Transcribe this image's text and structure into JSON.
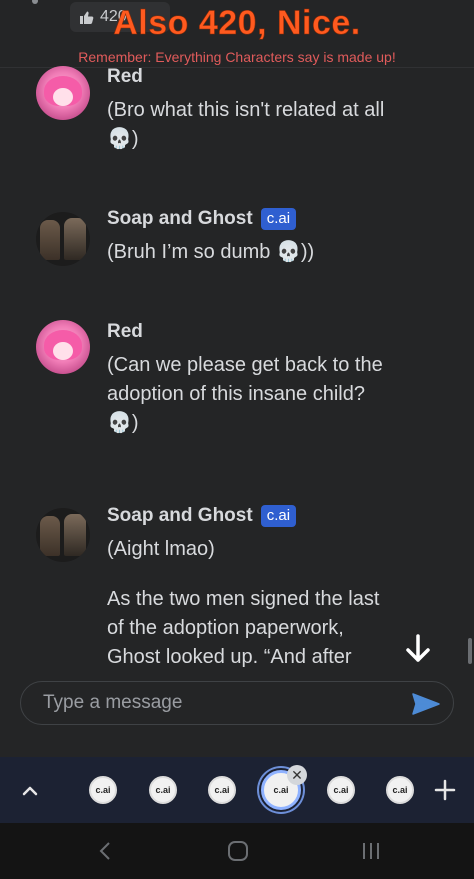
{
  "header": {
    "like_count": "420",
    "meme_caption": "Also 420, Nice.",
    "disclaimer": "Remember: Everything Characters say is made up!"
  },
  "messages": [
    {
      "author": "Red",
      "badge": "",
      "avatar": "pink-hair-avatar",
      "lines": [
        "(Bro what this isn't related at all",
        "💀)"
      ]
    },
    {
      "author": "Soap and Ghost",
      "badge": "c.ai",
      "avatar": "soap-ghost-avatar",
      "lines": [
        "(Bruh I’m so dumb 💀))"
      ]
    },
    {
      "author": "Red",
      "badge": "",
      "avatar": "pink-hair-avatar",
      "lines": [
        "(Can we please get back to the",
        "adoption of this insane child?",
        "💀)"
      ]
    },
    {
      "author": "Soap and Ghost",
      "badge": "c.ai",
      "avatar": "soap-ghost-avatar",
      "lines": [
        "(Aight lmao)"
      ],
      "paragraph2": [
        "As the two men signed the last",
        "of the adoption paperwork,",
        "Ghost looked up. “And after"
      ]
    }
  ],
  "composer": {
    "placeholder": "Type a message",
    "value": ""
  },
  "character_bar": {
    "chip_label": "c.ai",
    "count": 6,
    "active_index": 3
  },
  "colors": {
    "accent": "#2f5fd0",
    "send": "#4d8bd6",
    "caption": "#ff5a1f",
    "disclaimer": "#e05b5b"
  },
  "icons": [
    "thumbs-up-icon",
    "arrow-down-icon",
    "send-icon",
    "chevron-up-icon",
    "plus-icon",
    "close-icon",
    "nav-back-icon",
    "nav-home-icon",
    "nav-recent-icon"
  ]
}
